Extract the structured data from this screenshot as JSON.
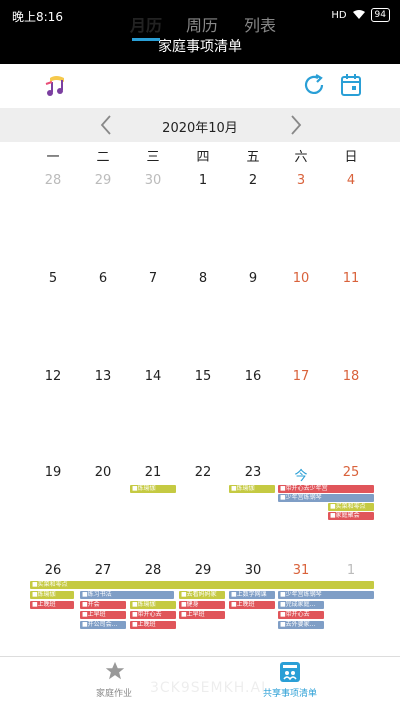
{
  "status": {
    "time": "晚上8:16",
    "signal": "HD",
    "battery": "94"
  },
  "title": "家庭事项清单",
  "tabs": [
    {
      "label": "月历"
    },
    {
      "label": "周历"
    },
    {
      "label": "列表"
    }
  ],
  "month_label": "2020年10月",
  "weekdays": [
    "一",
    "二",
    "三",
    "四",
    "五",
    "六",
    "日"
  ],
  "weeks": [
    [
      "28",
      "29",
      "30",
      "1",
      "2",
      "3",
      "4"
    ],
    [
      "5",
      "6",
      "7",
      "8",
      "9",
      "10",
      "11"
    ],
    [
      "12",
      "13",
      "14",
      "15",
      "16",
      "17",
      "18"
    ],
    [
      "19",
      "20",
      "21",
      "22",
      "23",
      "今",
      "25"
    ],
    [
      "26",
      "27",
      "28",
      "29",
      "30",
      "31",
      "1"
    ]
  ],
  "events": {
    "w4_wed": "■炼瑜伽",
    "w4_fri": "■炼瑜伽",
    "w4_sat1": "■带开心去少年宫",
    "w4_sat2": "■少年宫练钢琴",
    "w4_sun1": "■买菜和零点",
    "w4_sun2": "■家庭聚会",
    "w5_span": "■买菜和零点",
    "w5_mon1": "■炼瑜伽",
    "w5_mon2": "■上晚班",
    "w5_tue1": "■练习书法",
    "w5_tue2": "■开会",
    "w5_tue3": "■上早班",
    "w5_tue4": "■开公司会...",
    "w5_wed1": "■炼瑜伽",
    "w5_wed2": "■带开心去",
    "w5_wed3": "■上晚班",
    "w5_thu1": "■去看妈妈家",
    "w5_thu2": "■健身",
    "w5_thu3": "■上早班",
    "w5_fri1": "■上数学网课",
    "w5_fri2": "■上晚班",
    "w5_sat1": "■少年宫练钢琴",
    "w5_sat2": "■完成家庭...",
    "w5_sat3": "■带开心去",
    "w5_sat4": "■去外婆家..."
  },
  "bottom_nav": [
    {
      "label": "家庭作业"
    },
    {
      "label": "共享事项清单"
    }
  ],
  "watermark": "3CK9SEMKH.AI",
  "colors": {
    "accent": "#2a9fd6",
    "weekend": "#d9623b",
    "event_yellow": "#c5ca42",
    "event_red": "#e0555a",
    "event_blue": "#7f9ec6"
  }
}
